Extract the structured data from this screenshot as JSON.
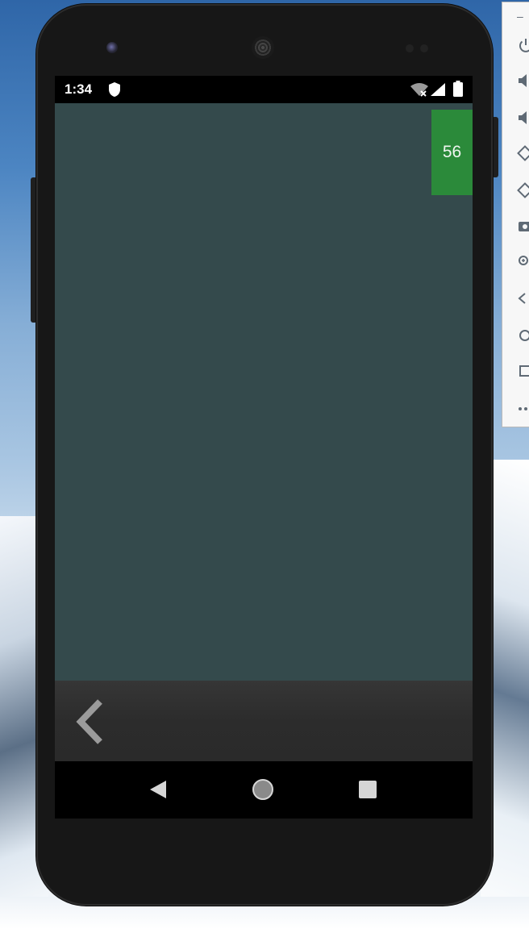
{
  "status_bar": {
    "time": "1:34",
    "icons": [
      "shield-icon",
      "wifi-off-icon",
      "signal-icon",
      "battery-icon"
    ]
  },
  "app": {
    "background_color": "#344a4c",
    "counter_value": "56",
    "counter_color": "#2b8a3a",
    "back_icon": "chevron-left-icon"
  },
  "system_nav": {
    "buttons": [
      "back-triangle-icon",
      "home-circle-icon",
      "recents-square-icon"
    ]
  },
  "emulator_toolbar": {
    "items": [
      "minimize-icon",
      "power-icon",
      "volume-up-icon",
      "volume-down-icon",
      "rotate-left-icon",
      "rotate-right-icon",
      "camera-icon",
      "zoom-icon",
      "back-icon",
      "home-icon",
      "overview-icon",
      "more-icon"
    ]
  }
}
